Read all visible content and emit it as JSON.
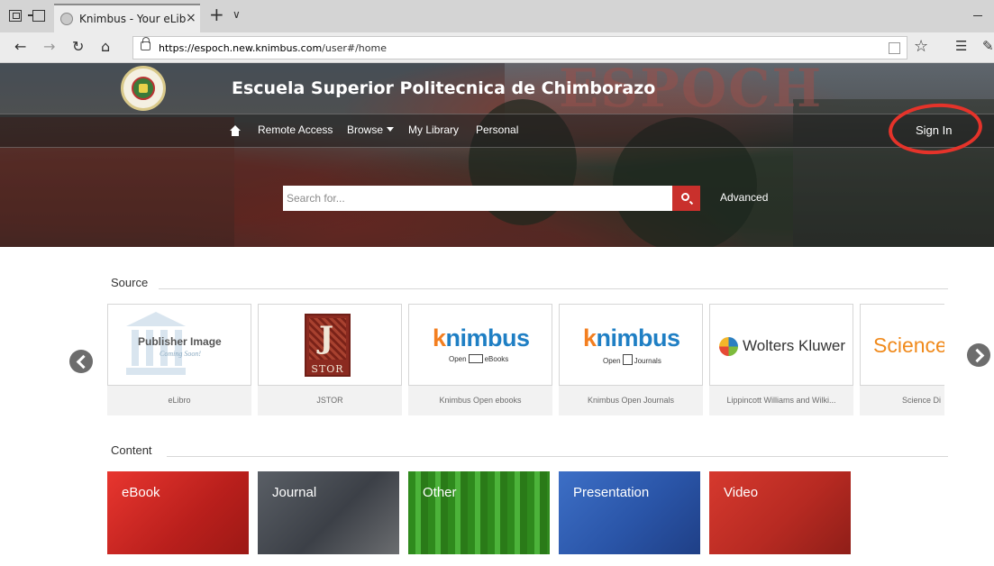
{
  "browser": {
    "tab_title": "Knimbus - Your eLibrary",
    "tab_close": "×",
    "new_tab": "+",
    "tab_menu": "∨",
    "url_host": "https://espoch.new.knimbus.com",
    "url_path": "/user#/home"
  },
  "site": {
    "title": "Escuela Superior Politecnica de Chimborazo",
    "bg_sign": "ESPOCH"
  },
  "menu": {
    "remote_access": "Remote Access",
    "browse": "Browse",
    "my_library": "My Library",
    "personal": "Personal",
    "sign_in": "Sign In"
  },
  "search": {
    "placeholder": "Search for...",
    "advanced": "Advanced"
  },
  "sections": {
    "source": "Source",
    "content": "Content"
  },
  "sources": [
    {
      "caption": "eLibro",
      "image_line1": "Publisher Image",
      "image_line2": "Coming Soon!"
    },
    {
      "caption": "JSTOR",
      "image_word": "STOR",
      "image_letter": "J"
    },
    {
      "caption": "Knimbus Open ebooks",
      "logo": "nimbus",
      "logo_k": "k",
      "sub_left": "Open",
      "sub_right": "eBooks"
    },
    {
      "caption": "Knimbus Open Journals",
      "logo": "nimbus",
      "logo_k": "k",
      "sub_left": "Open",
      "sub_right": "Journals"
    },
    {
      "caption": "Lippincott Williams and Wilki...",
      "logo_text": "Wolters Kluwer"
    },
    {
      "caption": "Science Di",
      "logo_text": "ScienceD"
    }
  ],
  "content_types": [
    {
      "label": "eBook",
      "color": "#d42a26"
    },
    {
      "label": "Journal",
      "color": "#4a4f57"
    },
    {
      "label": "Other",
      "color": "#3f9e2a"
    },
    {
      "label": "Presentation",
      "color": "#2f5fb3"
    },
    {
      "label": "Video",
      "color": "#c8322a"
    }
  ],
  "colors": {
    "accent_red": "#c9302c",
    "annotation_circle": "#e5332a"
  }
}
